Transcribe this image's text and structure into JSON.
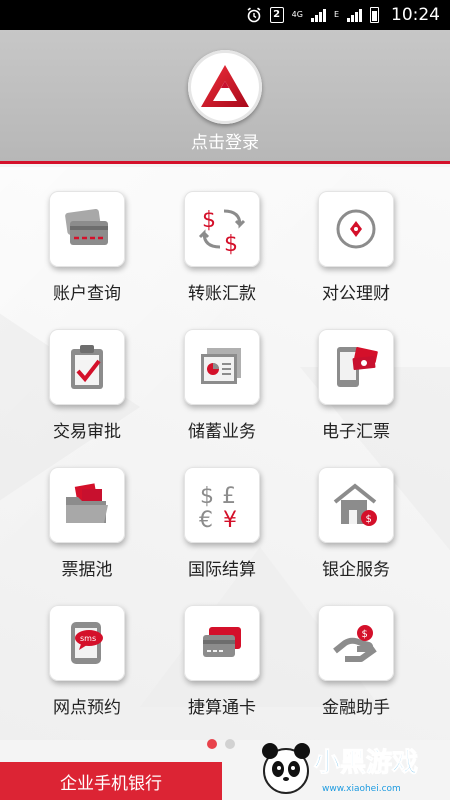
{
  "status_bar": {
    "sim_indicator": "2",
    "network_type": "4G",
    "network_e": "E",
    "time": "10:24"
  },
  "header": {
    "logo_icon": "bank-logo-icon",
    "login_text": "点击登录",
    "accent_color": "#d4102a"
  },
  "menu": {
    "items": [
      {
        "label": "账户查询",
        "icon": "bank-card-icon"
      },
      {
        "label": "转账汇款",
        "icon": "money-transfer-icon"
      },
      {
        "label": "对公理财",
        "icon": "wealth-coin-icon"
      },
      {
        "label": "交易审批",
        "icon": "clipboard-check-icon"
      },
      {
        "label": "储蓄业务",
        "icon": "savings-documents-icon"
      },
      {
        "label": "电子汇票",
        "icon": "mobile-bill-icon"
      },
      {
        "label": "票据池",
        "icon": "folder-documents-icon"
      },
      {
        "label": "国际结算",
        "icon": "currency-symbols-icon"
      },
      {
        "label": "银企服务",
        "icon": "house-coin-icon"
      },
      {
        "label": "网点预约",
        "icon": "sms-phone-icon"
      },
      {
        "label": "捷算通卡",
        "icon": "cards-icon"
      },
      {
        "label": "金融助手",
        "icon": "hand-coin-icon"
      }
    ]
  },
  "pager": {
    "total": 2,
    "active": 1
  },
  "bottom_tab": {
    "label": "企业手机银行"
  },
  "watermark": {
    "text": "小黑游戏",
    "url": "www.xiaohei.com"
  }
}
